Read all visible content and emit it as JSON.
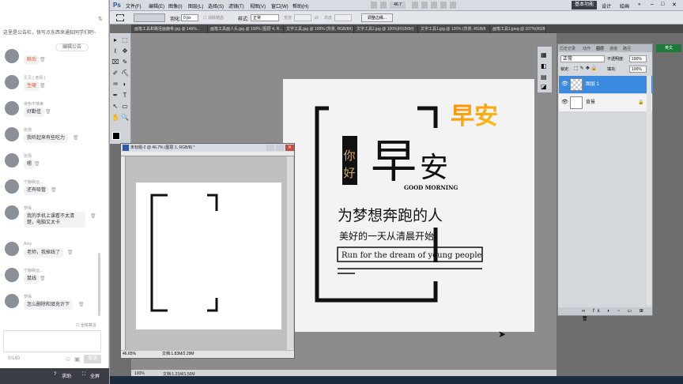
{
  "chat": {
    "notice": "这里是公告栏，快写点东西来通知同学们吧~",
    "edit_notice": "编辑公告",
    "messages": [
      {
        "name": "",
        "text": "醉后",
        "hot": true
      },
      {
        "name": "贝贝 [ 老师 ]",
        "text": "生硬",
        "hot": true
      },
      {
        "name": "夜色不够美",
        "text": "好勤佳",
        "hot": false
      },
      {
        "name": "张扬",
        "text": "我听起来有些吃力",
        "hot": false
      },
      {
        "name": "张扬",
        "text": "嗯",
        "hot": false
      },
      {
        "name": "宁静致远...",
        "text": "还有吸管",
        "hot": false
      },
      {
        "name": "梦缘",
        "text": "我的手机上课看不太清楚，电脑又太卡",
        "hot": false
      },
      {
        "name": "Amy",
        "text": "老师，我掉线了",
        "hot": false
      },
      {
        "name": "宁静致远...",
        "text": "鼠线",
        "hot": false
      },
      {
        "name": "梦缘",
        "text": "怎么删除和填充许下",
        "hot": false
      }
    ],
    "mute_all": "全体禁言",
    "char_count": "0/140",
    "send": "发送",
    "help": "求助",
    "fullscreen": "全屏"
  },
  "ps": {
    "logo": "Ps",
    "menus": [
      "文件(F)",
      "编辑(E)",
      "图像(I)",
      "图层(L)",
      "选择(S)",
      "滤镜(T)",
      "视图(V)",
      "窗口(W)",
      "帮助(H)"
    ],
    "zoom_top": "46.7",
    "workspace": [
      "基本功能",
      "设计",
      "绘画"
    ],
    "options": {
      "feather_label": "羽化:",
      "feather_value": "0 px",
      "antialias": "消除锯齿",
      "style_label": "样式:",
      "style_value": "正常",
      "width_label": "宽度",
      "height_label": "高度",
      "refine": "调整边缘..."
    },
    "doc_tabs": [
      "画笔工具和路径画鹿骨.jpg @ 146%...",
      "画笔工具画人头.jpg @ 100% (图层 4, R...",
      "文字工具.jpg @ 100% (背景, RGB/8#)",
      "文字工具2.jpg @ 100%(RGB/8#)",
      "文字工具1.jpg @ 126% (背景, RGB/8",
      "画笔工具1.jpeg @ 107%(RGB"
    ],
    "status_zoom": "100%",
    "status_doc": "文档:1.21M/1.50M",
    "right_tag": "英文"
  },
  "child_window": {
    "title": "未标题-2 @ 46.7% (图层 1, RGB/8) *",
    "zoom": "46.65%",
    "doc": "文档:1.83M/2.29M"
  },
  "design": {
    "nihao": "你好",
    "zao": "早",
    "an": "安",
    "zaoan_color": "早安",
    "good_morning": "GOOD MORNING",
    "line1": "为梦想奔跑的人",
    "line2": "美好的一天从清晨开始",
    "english": "Run for the dream of young people",
    "gradient_colors": [
      "#ff8c00",
      "#f7c41f"
    ]
  },
  "layers": {
    "tabs": [
      "历史记录",
      "动作",
      "图层",
      "通道",
      "路径"
    ],
    "blend_mode": "正常",
    "opacity_label": "不透明度:",
    "opacity_value": "100%",
    "lock_label": "锁定:",
    "fill_label": "填充:",
    "fill_value": "100%",
    "items": [
      {
        "name": "图层 1",
        "selected": true
      },
      {
        "name": "背景",
        "selected": false
      }
    ]
  }
}
